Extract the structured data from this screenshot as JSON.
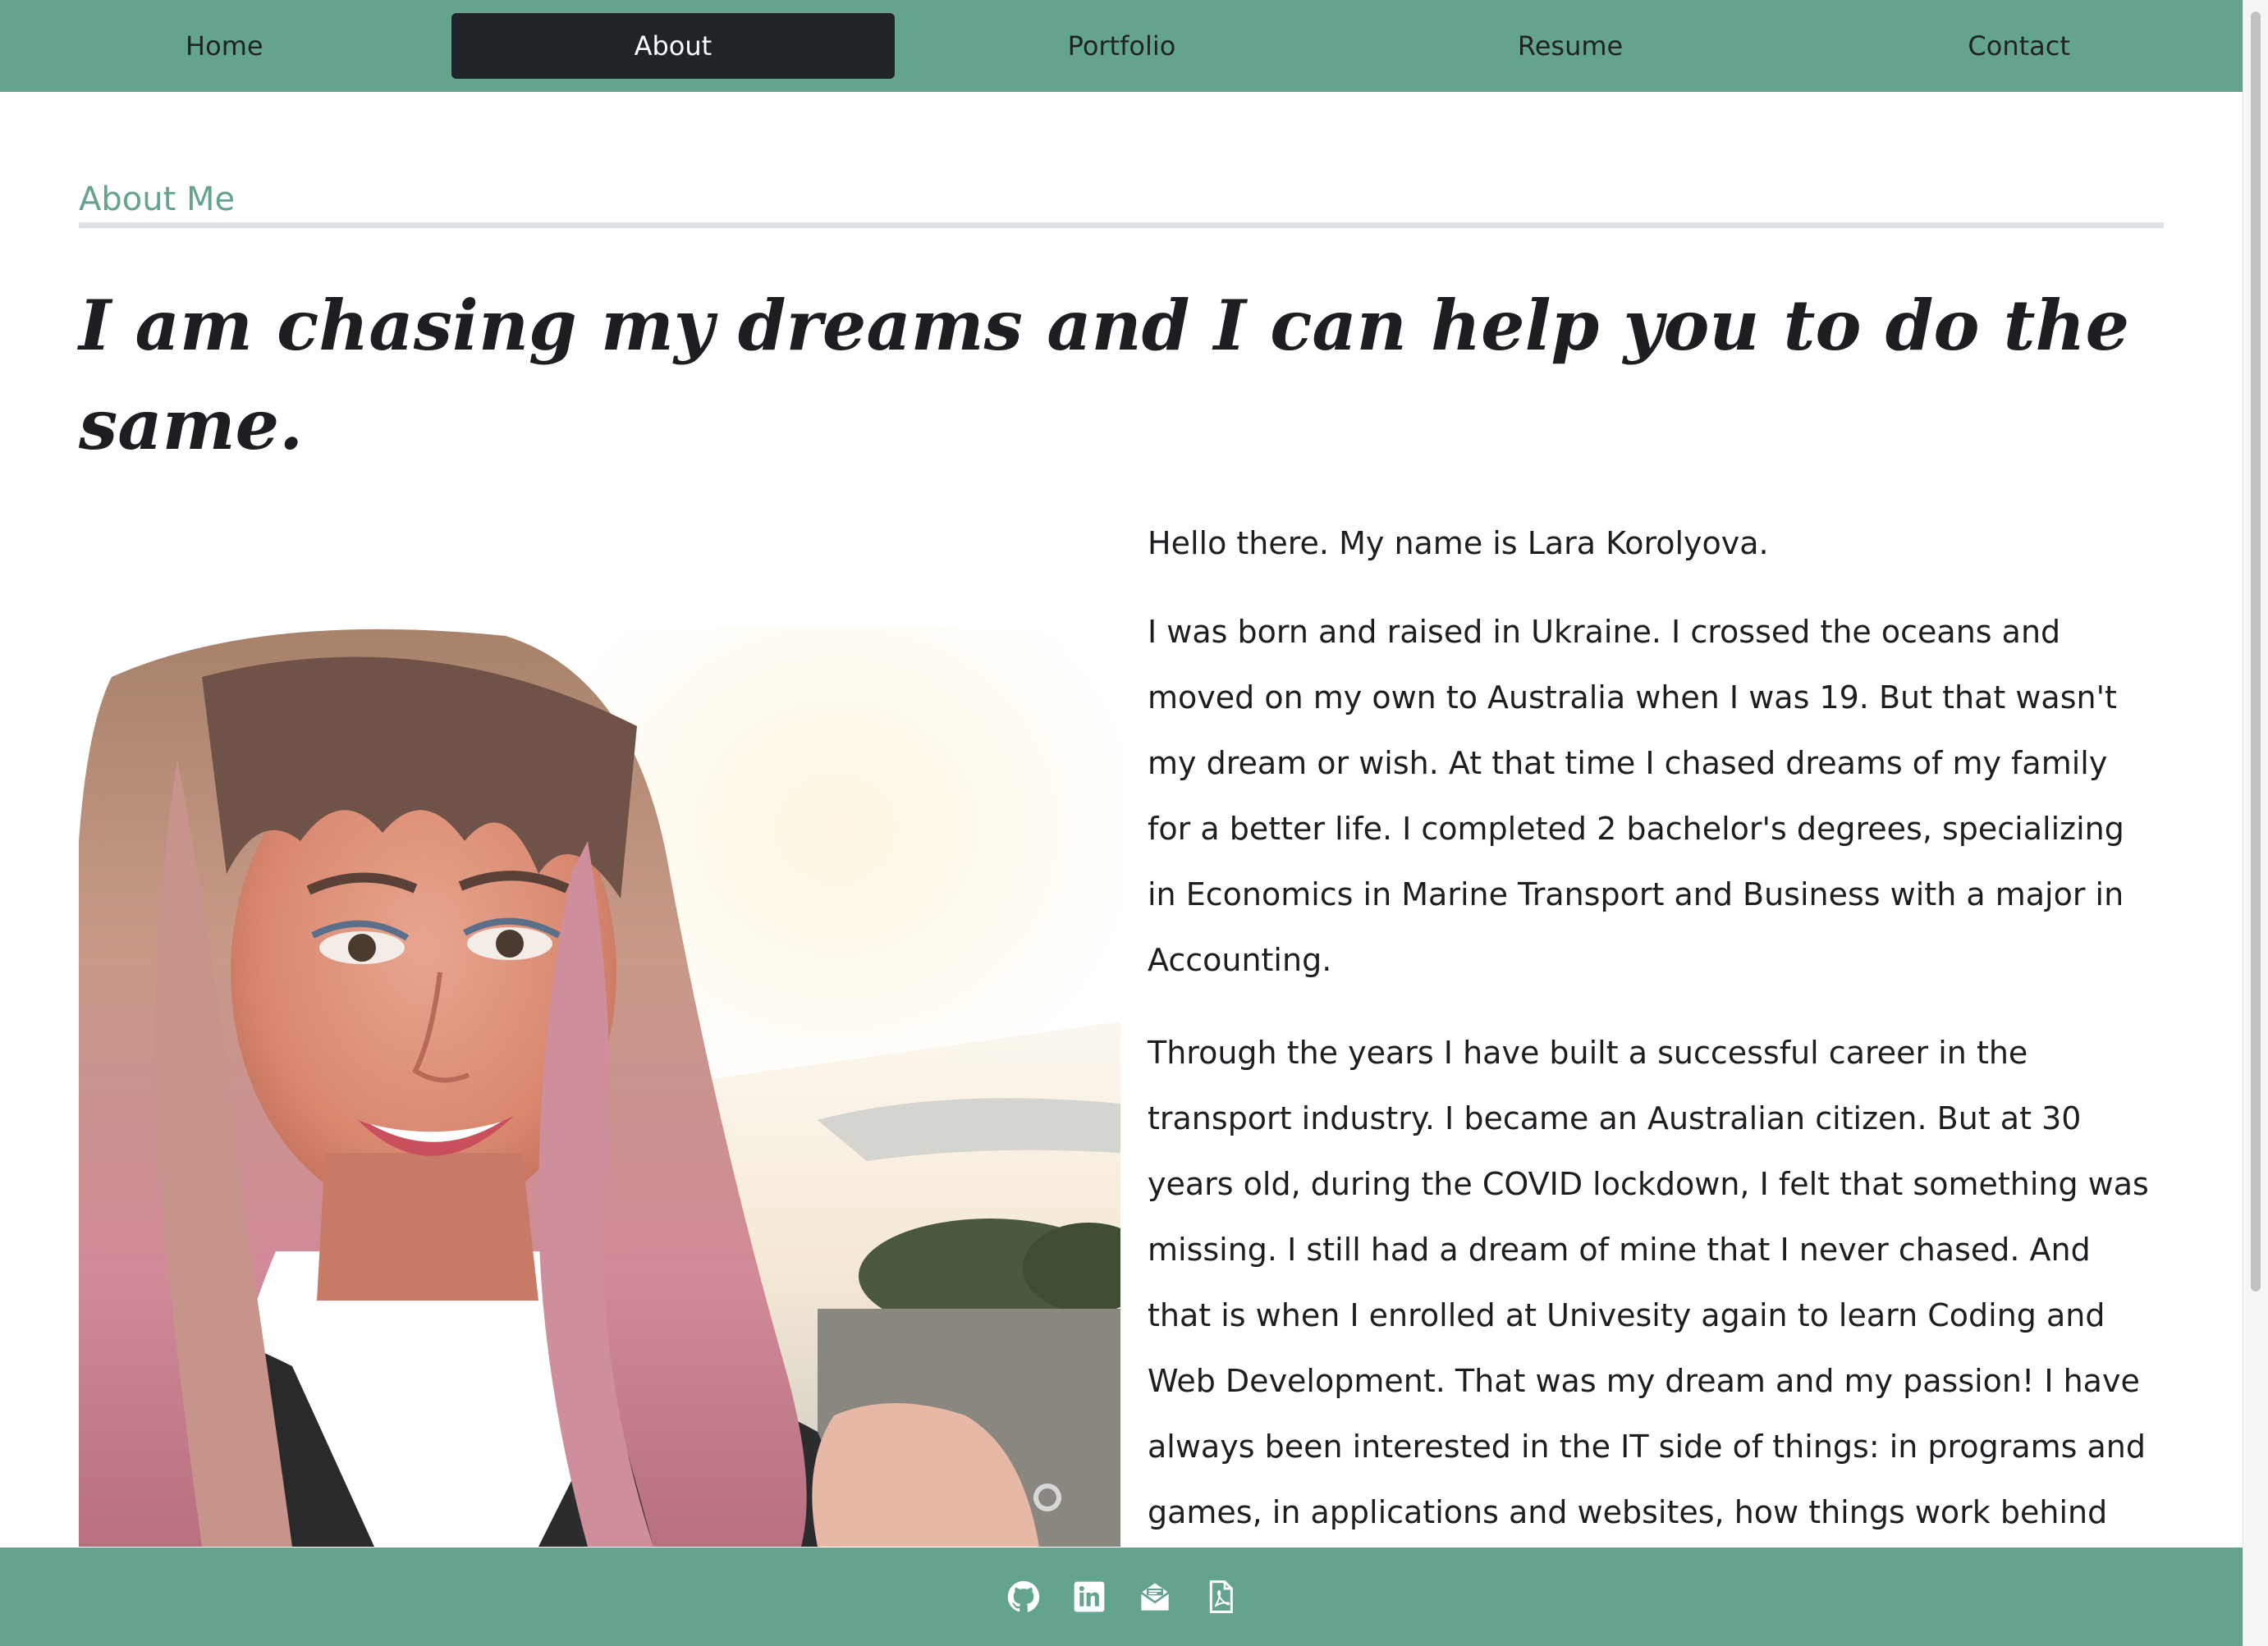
{
  "nav": {
    "items": [
      {
        "label": "Home",
        "active": false
      },
      {
        "label": "About",
        "active": true
      },
      {
        "label": "Portfolio",
        "active": false
      },
      {
        "label": "Resume",
        "active": false
      },
      {
        "label": "Contact",
        "active": false
      }
    ]
  },
  "about": {
    "section_label": "About Me",
    "headline": "I am chasing my dreams and I can help you to do the same.",
    "photo_alt": "Portrait of Lara Korolyova",
    "paragraphs": [
      "Hello there. My name is Lara Korolyova.",
      "I was born and raised in Ukraine. I crossed the oceans and moved on my own to Australia when I was 19. But that wasn't my dream or wish. At that time I chased dreams of my family for a better life. I completed 2 bachelor's degrees, specializing in Economics in Marine Transport and Business with a major in Accounting.",
      "Through the years I have built a successful career in the transport industry. I became an Australian citizen. But at 30 years old, during the COVID lockdown, I felt that something was missing. I still had a dream of mine that I never chased. And that is when I enrolled at Univesity again to learn Coding and Web Development. That was my dream and my passion! I have always been interested in the IT side of things: in programs and games, in applications and websites, how things work behind"
    ]
  },
  "footer": {
    "icons": [
      "github-icon",
      "linkedin-icon",
      "email-icon",
      "pdf-icon"
    ]
  },
  "colors": {
    "accent": "#64a48f",
    "nav_active_bg": "#202428",
    "text": "#1c1e21",
    "rule": "#dde2e6"
  }
}
